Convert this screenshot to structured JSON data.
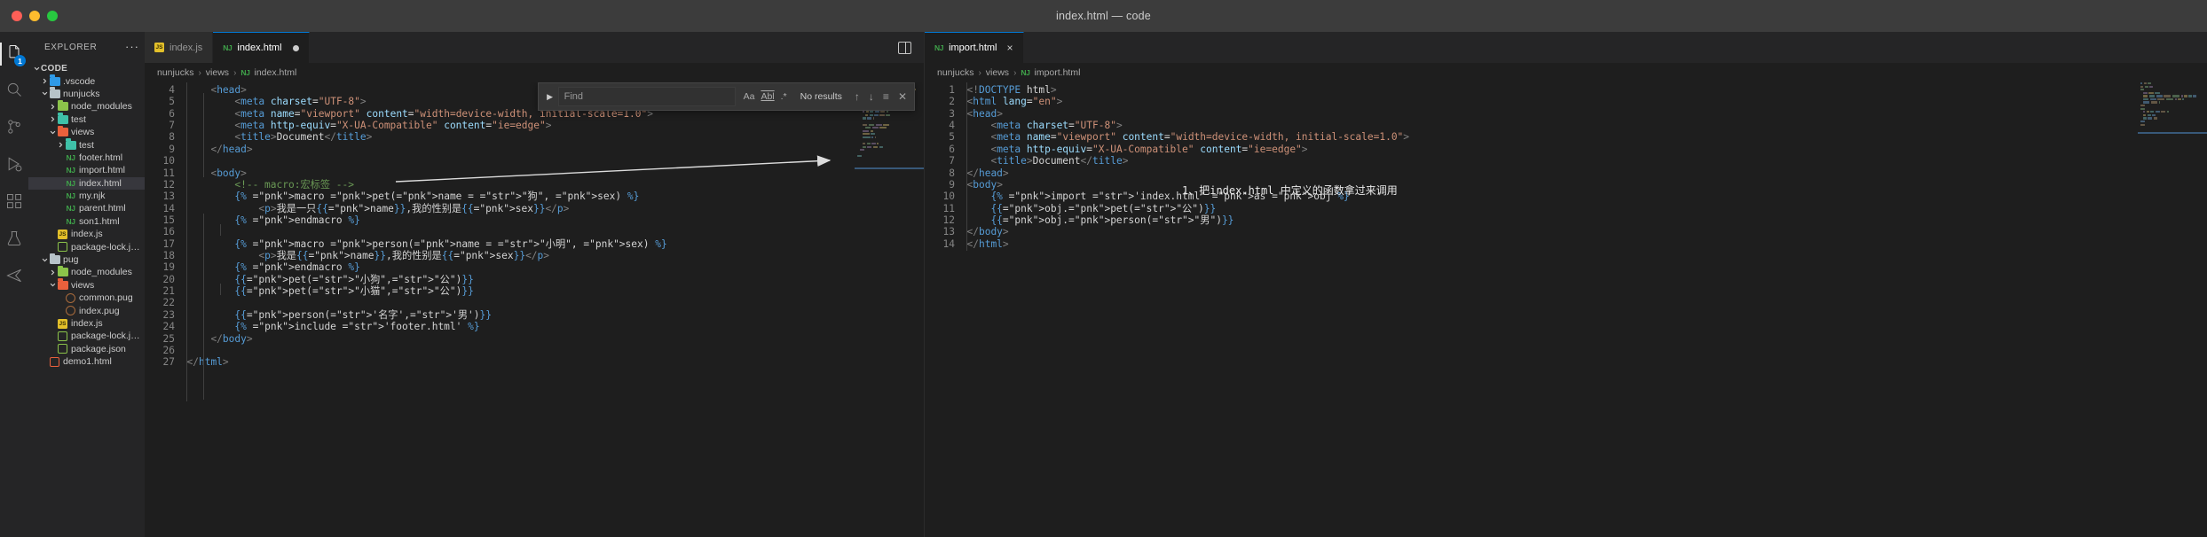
{
  "window": {
    "title": "index.html — code",
    "traffic_lights": [
      "close",
      "minimize",
      "maximize"
    ]
  },
  "activity_bar": {
    "items": [
      {
        "name": "explorer",
        "icon": "files-icon",
        "badge": "1",
        "active": true
      },
      {
        "name": "search",
        "icon": "search-icon",
        "badge": null,
        "active": false
      },
      {
        "name": "source-control",
        "icon": "source-control-icon",
        "badge": null,
        "active": false
      },
      {
        "name": "run-and-debug",
        "icon": "debug-icon",
        "badge": null,
        "active": false
      },
      {
        "name": "extensions",
        "icon": "extensions-icon",
        "badge": null,
        "active": false
      },
      {
        "name": "remote-explorer",
        "icon": "remote-icon",
        "badge": null,
        "active": false
      },
      {
        "name": "test-explorer",
        "icon": "beaker-icon",
        "badge": null,
        "active": false
      }
    ]
  },
  "sidebar": {
    "title": "EXPLORER",
    "more_label": "···",
    "tree": [
      {
        "label": "CODE",
        "depth": 0,
        "type": "root",
        "expanded": true,
        "selected": false
      },
      {
        "label": ".vscode",
        "depth": 1,
        "type": "folder-vscode",
        "expanded": false,
        "selected": false
      },
      {
        "label": "nunjucks",
        "depth": 1,
        "type": "folder",
        "expanded": true,
        "selected": false
      },
      {
        "label": "node_modules",
        "depth": 2,
        "type": "folder-npm",
        "expanded": false,
        "selected": false
      },
      {
        "label": "test",
        "depth": 2,
        "type": "folder-test",
        "expanded": false,
        "selected": false
      },
      {
        "label": "views",
        "depth": 2,
        "type": "folder-views",
        "expanded": true,
        "selected": false
      },
      {
        "label": "test",
        "depth": 3,
        "type": "folder-test",
        "expanded": false,
        "selected": false
      },
      {
        "label": "footer.html",
        "depth": 3,
        "type": "njk",
        "selected": false
      },
      {
        "label": "import.html",
        "depth": 3,
        "type": "njk",
        "selected": false
      },
      {
        "label": "index.html",
        "depth": 3,
        "type": "njk",
        "selected": true
      },
      {
        "label": "my.njk",
        "depth": 3,
        "type": "njk",
        "selected": false
      },
      {
        "label": "parent.html",
        "depth": 3,
        "type": "njk",
        "selected": false
      },
      {
        "label": "son1.html",
        "depth": 3,
        "type": "njk",
        "selected": false
      },
      {
        "label": "index.js",
        "depth": 2,
        "type": "js",
        "selected": false
      },
      {
        "label": "package-lock.j…",
        "depth": 2,
        "type": "json",
        "selected": false
      },
      {
        "label": "pug",
        "depth": 1,
        "type": "folder",
        "expanded": true,
        "selected": false
      },
      {
        "label": "node_modules",
        "depth": 2,
        "type": "folder-npm",
        "expanded": false,
        "selected": false
      },
      {
        "label": "views",
        "depth": 2,
        "type": "folder-views",
        "expanded": true,
        "selected": false
      },
      {
        "label": "common.pug",
        "depth": 3,
        "type": "pug",
        "selected": false
      },
      {
        "label": "index.pug",
        "depth": 3,
        "type": "pug",
        "selected": false
      },
      {
        "label": "index.js",
        "depth": 2,
        "type": "js",
        "selected": false
      },
      {
        "label": "package-lock.j…",
        "depth": 2,
        "type": "json",
        "selected": false
      },
      {
        "label": "package.json",
        "depth": 2,
        "type": "json",
        "selected": false
      },
      {
        "label": "demo1.html",
        "depth": 1,
        "type": "html",
        "selected": false
      }
    ]
  },
  "left_editor": {
    "tabs": [
      {
        "label": "index.js",
        "icon": "js-icon",
        "active": false,
        "dirty": false
      },
      {
        "label": "index.html",
        "icon": "njk-icon",
        "active": true,
        "dirty": true
      }
    ],
    "breadcrumb": [
      "nunjucks",
      "views",
      "index.html"
    ],
    "first_line_number": 4,
    "lines": [
      {
        "n": 4,
        "text": "    <head>"
      },
      {
        "n": 5,
        "text": "        <meta charset=\"UTF-8\">"
      },
      {
        "n": 6,
        "text": "        <meta name=\"viewport\" content=\"width=device-width, initial-scale=1.0\">"
      },
      {
        "n": 7,
        "text": "        <meta http-equiv=\"X-UA-Compatible\" content=\"ie=edge\">"
      },
      {
        "n": 8,
        "text": "        <title>Document</title>"
      },
      {
        "n": 9,
        "text": "    </head>"
      },
      {
        "n": 10,
        "text": ""
      },
      {
        "n": 11,
        "text": "    <body>"
      },
      {
        "n": 12,
        "text": "        <!-- macro:宏标签 -->"
      },
      {
        "n": 13,
        "text": "        {% macro pet(name = \"狗\", sex) %}"
      },
      {
        "n": 14,
        "text": "            <p>我是一只{{name}},我的性别是{{sex}}</p>"
      },
      {
        "n": 15,
        "text": "        {% endmacro %}"
      },
      {
        "n": 16,
        "text": ""
      },
      {
        "n": 17,
        "text": "        {% macro person(name = \"小明\", sex) %}"
      },
      {
        "n": 18,
        "text": "            <p>我是{{name}},我的性别是{{sex}}</p>"
      },
      {
        "n": 19,
        "text": "        {% endmacro %}"
      },
      {
        "n": 20,
        "text": "        {{pet(\"小狗\",\"公\")}}"
      },
      {
        "n": 21,
        "text": "        {{pet(\"小猫\",\"公\")}}"
      },
      {
        "n": 22,
        "text": ""
      },
      {
        "n": 23,
        "text": "        {{person('名字','男')}}"
      },
      {
        "n": 24,
        "text": "        {% include 'footer.html' %}"
      },
      {
        "n": 25,
        "text": "    </body>"
      },
      {
        "n": 26,
        "text": ""
      },
      {
        "n": 27,
        "text": "</html>"
      }
    ]
  },
  "find_widget": {
    "placeholder": "Find",
    "value": "",
    "toggle_icons": [
      "Aa",
      "Abl",
      ".*"
    ],
    "result_text": "No results",
    "nav_icons": [
      "previous-match",
      "next-match",
      "find-in-selection",
      "close"
    ]
  },
  "right_editor": {
    "tabs": [
      {
        "label": "import.html",
        "icon": "njk-icon",
        "active": true,
        "dirty": false,
        "close": "×"
      }
    ],
    "breadcrumb": [
      "nunjucks",
      "views",
      "import.html"
    ],
    "first_line_number": 1,
    "lines": [
      {
        "n": 1,
        "text": "<!DOCTYPE html>"
      },
      {
        "n": 2,
        "text": "<html lang=\"en\">"
      },
      {
        "n": 3,
        "text": "<head>"
      },
      {
        "n": 4,
        "text": "    <meta charset=\"UTF-8\">"
      },
      {
        "n": 5,
        "text": "    <meta name=\"viewport\" content=\"width=device-width, initial-scale=1.0\">"
      },
      {
        "n": 6,
        "text": "    <meta http-equiv=\"X-UA-Compatible\" content=\"ie=edge\">"
      },
      {
        "n": 7,
        "text": "    <title>Document</title>"
      },
      {
        "n": 8,
        "text": "</head>"
      },
      {
        "n": 9,
        "text": "<body>"
      },
      {
        "n": 10,
        "text": "    {% import 'index.html' as obj %}"
      },
      {
        "n": 11,
        "text": "    {{obj.pet(\"公\")}}"
      },
      {
        "n": 12,
        "text": "    {{obj.person(\"男\")}}"
      },
      {
        "n": 13,
        "text": "</body>"
      },
      {
        "n": 14,
        "text": "</html>"
      }
    ],
    "annotation": "1、把index.html 中定义的函数拿过来调用"
  },
  "colors": {
    "accent": "#0078d4",
    "titlebar_bg": "#3c3c3c",
    "sidebar_bg": "#252526",
    "editor_bg": "#1e1e1e",
    "selection_bg": "#37373d",
    "njk_green": "#3fa34a",
    "js_yellow": "#e3c02a"
  }
}
